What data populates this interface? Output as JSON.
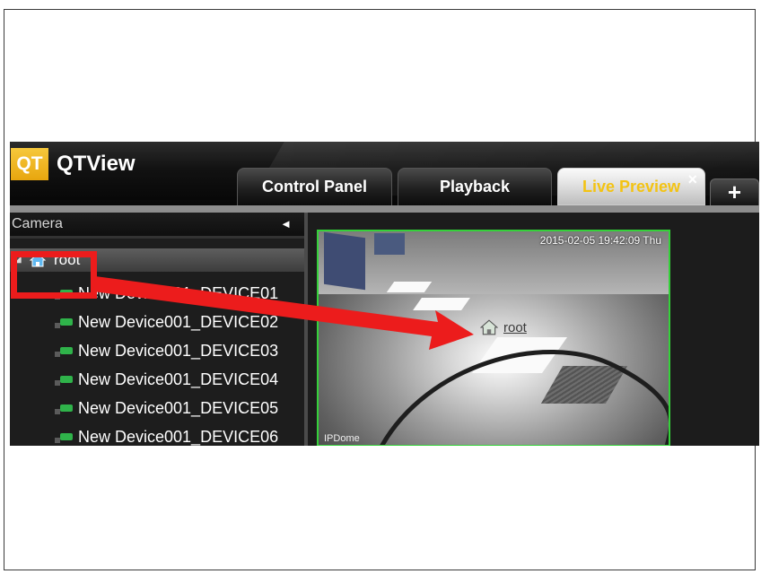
{
  "app": {
    "logo_text": "QT",
    "title": "QTView"
  },
  "tabs": [
    {
      "label": "Control Panel",
      "active": false
    },
    {
      "label": "Playback",
      "active": false
    },
    {
      "label": "Live Preview",
      "active": true
    }
  ],
  "tab_close_glyph": "×",
  "tab_add_glyph": "+",
  "sidebar": {
    "header": "Camera",
    "collapse_glyph": "◄",
    "root_label": "root",
    "devices": [
      "New Device001_DEVICE01",
      "New Device001_DEVICE02",
      "New Device001_DEVICE03",
      "New Device001_DEVICE04",
      "New Device001_DEVICE05",
      "New Device001_DEVICE06"
    ]
  },
  "video": {
    "timestamp": "2015-02-05 19:42:09 Thu",
    "camera_name": "IPDome",
    "overlay_label": "root",
    "border_color": "#35d13a"
  },
  "annotation": {
    "color": "#ec1c1c",
    "arrow_from": "root-tree-node",
    "arrow_to": "video-root-overlay"
  },
  "icons": {
    "home": "home-icon",
    "camera": "camera-icon"
  }
}
